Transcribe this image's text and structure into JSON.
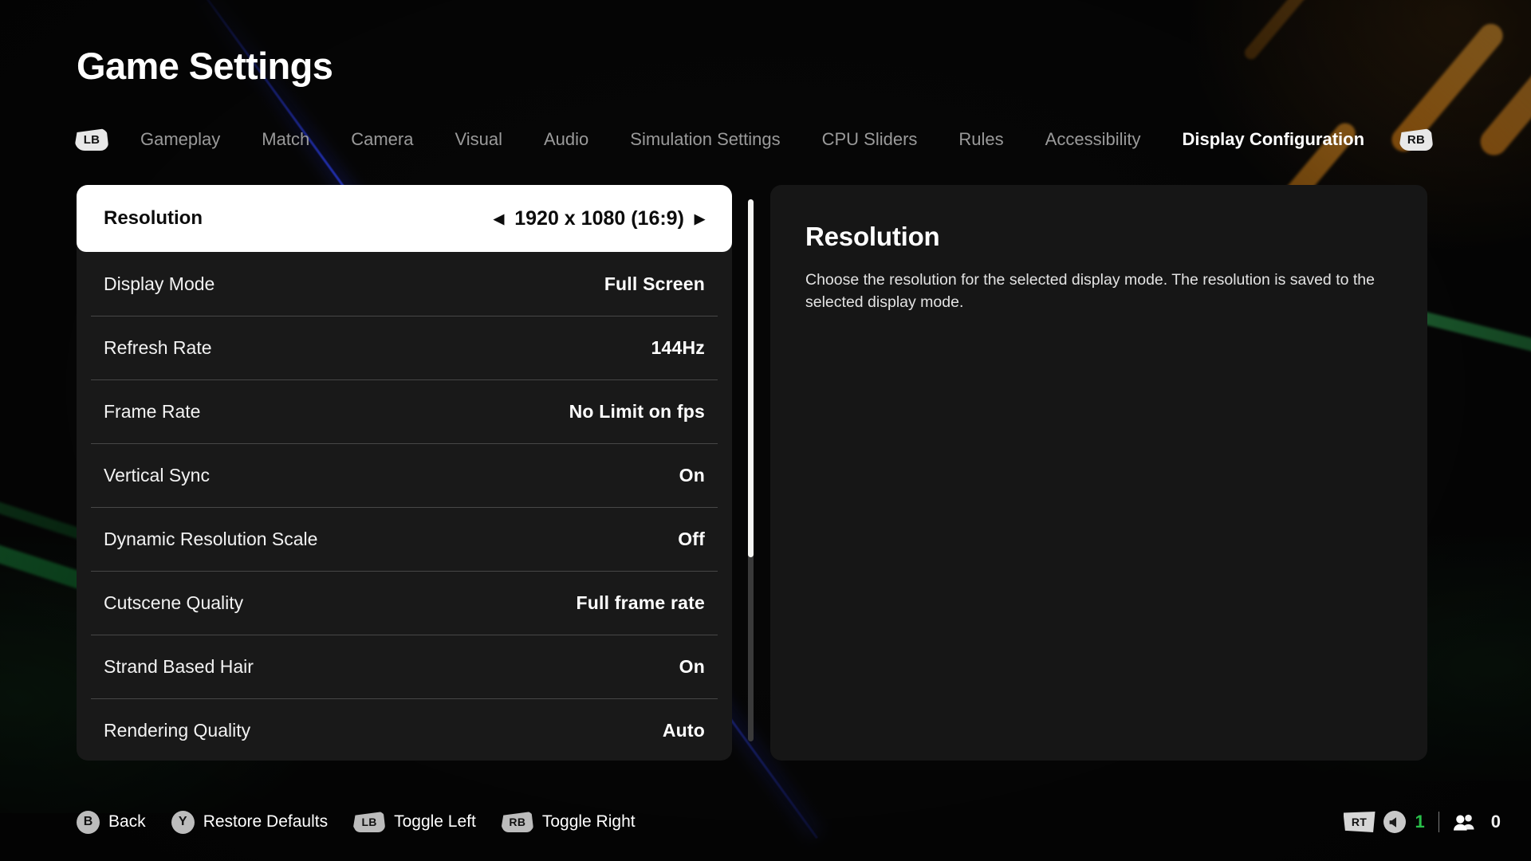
{
  "header": {
    "title": "Game Settings"
  },
  "tabs": {
    "left_bumper": "LB",
    "right_bumper": "RB",
    "items": [
      {
        "label": "Gameplay",
        "active": false
      },
      {
        "label": "Match",
        "active": false
      },
      {
        "label": "Camera",
        "active": false
      },
      {
        "label": "Visual",
        "active": false
      },
      {
        "label": "Audio",
        "active": false
      },
      {
        "label": "Simulation Settings",
        "active": false
      },
      {
        "label": "CPU Sliders",
        "active": false
      },
      {
        "label": "Rules",
        "active": false
      },
      {
        "label": "Accessibility",
        "active": false
      },
      {
        "label": "Display Configuration",
        "active": true
      }
    ]
  },
  "settings": {
    "selected_index": 0,
    "left_arrow": "◀",
    "right_arrow": "▶",
    "rows": [
      {
        "label": "Resolution",
        "value": "1920 x 1080 (16:9)",
        "selected": true
      },
      {
        "label": "Display Mode",
        "value": "Full Screen",
        "selected": false
      },
      {
        "label": "Refresh Rate",
        "value": "144Hz",
        "selected": false
      },
      {
        "label": "Frame Rate",
        "value": "No Limit on fps",
        "selected": false
      },
      {
        "label": "Vertical Sync",
        "value": "On",
        "selected": false
      },
      {
        "label": "Dynamic Resolution Scale",
        "value": "Off",
        "selected": false
      },
      {
        "label": "Cutscene Quality",
        "value": "Full frame rate",
        "selected": false
      },
      {
        "label": "Strand Based Hair",
        "value": "On",
        "selected": false
      },
      {
        "label": "Rendering Quality",
        "value": "Auto",
        "selected": false
      }
    ]
  },
  "scrollbar": {
    "thumb_percent": 66
  },
  "description": {
    "title": "Resolution",
    "body": "Choose the resolution for the selected display mode. The resolution is saved to the selected display mode."
  },
  "footer": {
    "hints": [
      {
        "button": "B",
        "shape": "circle",
        "label": "Back"
      },
      {
        "button": "Y",
        "shape": "circle",
        "label": "Restore Defaults"
      },
      {
        "button": "LB",
        "shape": "bumper",
        "label": "Toggle Left"
      },
      {
        "button": "RB",
        "shape": "bumper",
        "label": "Toggle Right"
      }
    ]
  },
  "status": {
    "trigger": "RT",
    "audio_count": "1",
    "party_count": "0"
  },
  "colors": {
    "background": "#060606",
    "panel": "#191919",
    "desc_panel": "#161616",
    "selected_row": "#ffffff",
    "accent_green": "#29c04a",
    "streak_orange": "#c8801f",
    "streak_green": "#1e7a3a",
    "streak_blue": "#2636c8"
  }
}
